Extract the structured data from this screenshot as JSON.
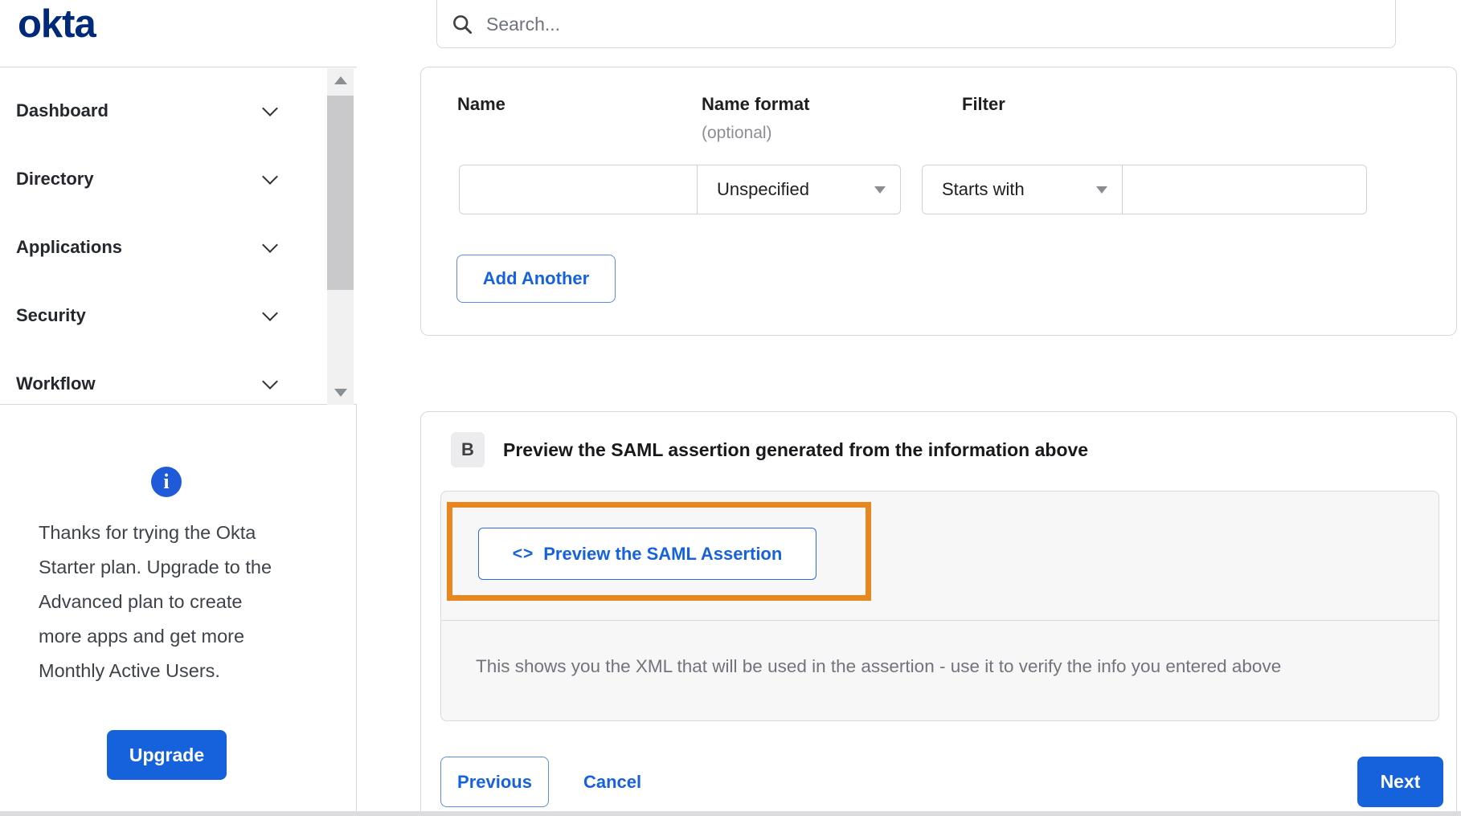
{
  "brand": {
    "logo_text": "okta",
    "navy": "#00297a"
  },
  "header": {
    "search_placeholder": "Search..."
  },
  "sidebar": {
    "items": [
      {
        "label": "Dashboard"
      },
      {
        "label": "Directory"
      },
      {
        "label": "Applications"
      },
      {
        "label": "Security"
      },
      {
        "label": "Workflow"
      }
    ],
    "upsell": {
      "info_glyph": "i",
      "message": "Thanks for trying the Okta Starter plan. Upgrade to the Advanced plan to create more apps and get more Monthly Active Users.",
      "upgrade_label": "Upgrade"
    }
  },
  "form": {
    "columns": [
      {
        "label": "Name"
      },
      {
        "label": "Name format",
        "sub": "(optional)"
      },
      {
        "label": "Filter"
      }
    ],
    "name_value": "",
    "name_format_value": "Unspecified",
    "filter_operator_value": "Starts with",
    "filter_value": "",
    "add_another_label": "Add Another"
  },
  "section_b": {
    "badge": "B",
    "title": "Preview the SAML assertion generated from the information above",
    "code_icon_glyph": "<>",
    "preview_button_label": "Preview the SAML Assertion",
    "description": "This shows you the XML that will be used in the assertion - use it to verify the info you entered above"
  },
  "footer": {
    "previous_label": "Previous",
    "cancel_label": "Cancel",
    "next_label": "Next"
  },
  "colors": {
    "primary_blue": "#1662dd",
    "brand_navy": "#00297a",
    "highlight_orange": "#e8871e"
  }
}
